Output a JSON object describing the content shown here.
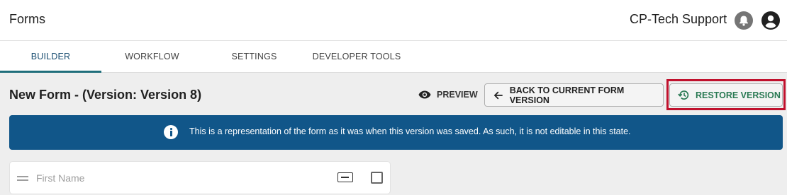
{
  "header": {
    "app_title": "Forms",
    "user_name": "CP-Tech Support",
    "icons": [
      "bell-icon",
      "account-circle-icon"
    ]
  },
  "tabs": [
    {
      "label": "BUILDER",
      "active": true
    },
    {
      "label": "WORKFLOW",
      "active": false
    },
    {
      "label": "SETTINGS",
      "active": false
    },
    {
      "label": "DEVELOPER TOOLS",
      "active": false
    }
  ],
  "toolbar": {
    "heading": "New Form - (Version: Version 8)",
    "preview_label": "PREVIEW",
    "back_label": "BACK TO CURRENT FORM VERSION",
    "restore_label": "RESTORE VERSION"
  },
  "banner": {
    "text": "This is a representation of the form as it was when this version was saved. As such, it is not editable in this state."
  },
  "fields": [
    {
      "label": "First Name"
    }
  ],
  "colors": {
    "accent": "#1f6e7b",
    "banner": "#115689",
    "restore_text": "#2a7a54",
    "highlight": "#c0112d"
  }
}
